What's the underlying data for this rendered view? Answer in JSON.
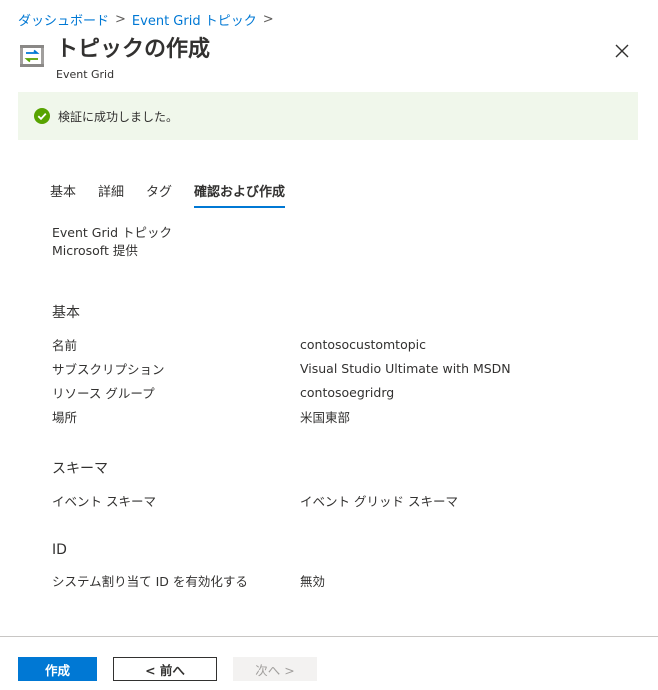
{
  "breadcrumb": {
    "items": [
      "ダッシュボード",
      "Event Grid トピック"
    ],
    "separator": ">"
  },
  "header": {
    "title": "トピックの作成",
    "subtitle": "Event Grid",
    "icon": "event-grid-topic-icon"
  },
  "banner": {
    "text": "検証に成功しました。",
    "icon": "check-circle-icon",
    "color": "#57a300"
  },
  "tabs": [
    {
      "label": "基本",
      "active": false
    },
    {
      "label": "詳細",
      "active": false
    },
    {
      "label": "タグ",
      "active": false
    },
    {
      "label": "確認および作成",
      "active": true
    }
  ],
  "product": {
    "name": "Event Grid トピック",
    "provider": "Microsoft 提供"
  },
  "sections": [
    {
      "title": "基本",
      "rows": [
        {
          "label": "名前",
          "value": "contosocustomtopic"
        },
        {
          "label": "サブスクリプション",
          "value": "Visual Studio Ultimate with MSDN"
        },
        {
          "label": "リソース グループ",
          "value": "contosoegridrg"
        },
        {
          "label": "場所",
          "value": "米国東部"
        }
      ]
    },
    {
      "title": "スキーマ",
      "rows": [
        {
          "label": "イベント スキーマ",
          "value": "イベント グリッド スキーマ"
        }
      ]
    },
    {
      "title": "ID",
      "rows": [
        {
          "label": "システム割り当て ID を有効化する",
          "value": "無効"
        }
      ]
    }
  ],
  "footer": {
    "create_label": "作成",
    "previous_label": "< 前へ",
    "next_label": "次へ >"
  },
  "colors": {
    "accent": "#0078d4",
    "banner_bg": "#f0f7eb",
    "success": "#57a300"
  }
}
